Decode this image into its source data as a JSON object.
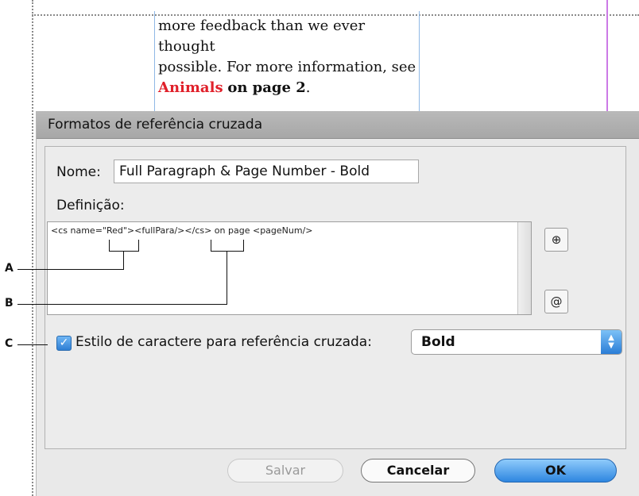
{
  "preview": {
    "line1": "more feedback than we ever thought",
    "line2": "possible. For more information, see",
    "link_red": "Animals",
    "link_bold": "on page 2",
    "period": "."
  },
  "dialog": {
    "title": "Formatos de referência cruzada",
    "name_label": "Nome:",
    "name_value": "Full Paragraph & Page Number - Bold",
    "definition_label": "Definição:",
    "definition_parts": {
      "p1": "<cs name=\"",
      "red": "Red",
      "p2": "\"><fullPara/>",
      "cs_close": "</cs>",
      "p3": " on page <pageNum/>"
    },
    "insert_text_button": "⊕",
    "insert_special_button": "@",
    "char_style_checkbox_label": "Estilo de caractere para referência cruzada:",
    "char_style_checked": true,
    "char_style_value": "Bold",
    "buttons": {
      "save": "Salvar",
      "cancel": "Cancelar",
      "ok": "OK"
    }
  },
  "callouts": {
    "a": "A",
    "b": "B",
    "c": "C"
  },
  "colors": {
    "accent": "#2e86e0",
    "red_text": "#e0202a",
    "margin_guide": "#cc7ae6"
  }
}
